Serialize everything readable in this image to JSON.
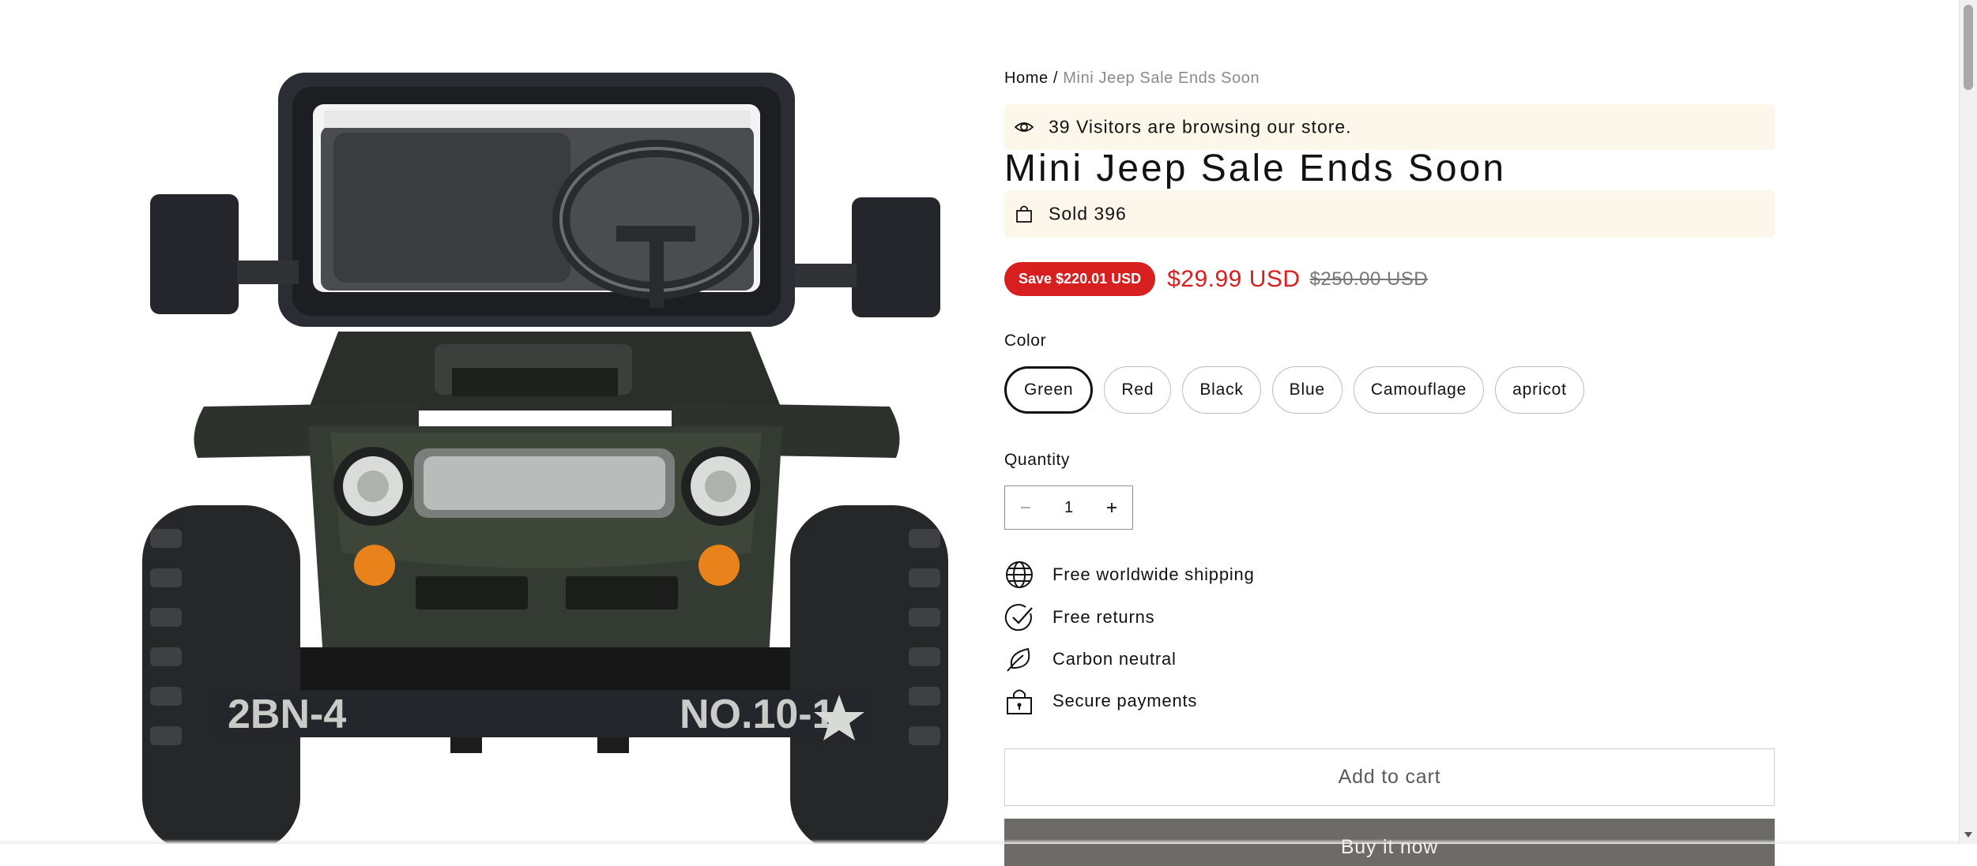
{
  "breadcrumb": {
    "home": "Home",
    "separator": "/",
    "current": "Mini Jeep Sale Ends Soon"
  },
  "visitors_notice": {
    "icon": "eye-icon",
    "text": "39 Visitors are browsing our store."
  },
  "product": {
    "title": "Mini Jeep Sale Ends Soon",
    "image_alt": "Mini Jeep",
    "plate_left": "2BN-4",
    "plate_right": "NO.10-1"
  },
  "sold_notice": {
    "icon": "shopping-bag-icon",
    "text": "Sold 396"
  },
  "pricing": {
    "save_badge": "Save $220.01 USD",
    "price": "$29.99 USD",
    "compare_at": "$250.00 USD",
    "accent_color": "#d81f1f"
  },
  "color_option": {
    "label": "Color",
    "selected": "Green",
    "options": [
      "Green",
      "Red",
      "Black",
      "Blue",
      "Camouflage",
      "apricot"
    ]
  },
  "quantity": {
    "label": "Quantity",
    "value": "1",
    "minus_icon": "minus-icon",
    "plus_icon": "plus-icon"
  },
  "benefits": [
    {
      "icon": "globe-icon",
      "text": "Free worldwide shipping"
    },
    {
      "icon": "check-circle-icon",
      "text": "Free returns"
    },
    {
      "icon": "leaf-icon",
      "text": "Carbon neutral"
    },
    {
      "icon": "lock-icon",
      "text": "Secure payments"
    }
  ],
  "actions": {
    "add_to_cart": "Add to cart",
    "buy_now": "Buy it now"
  }
}
